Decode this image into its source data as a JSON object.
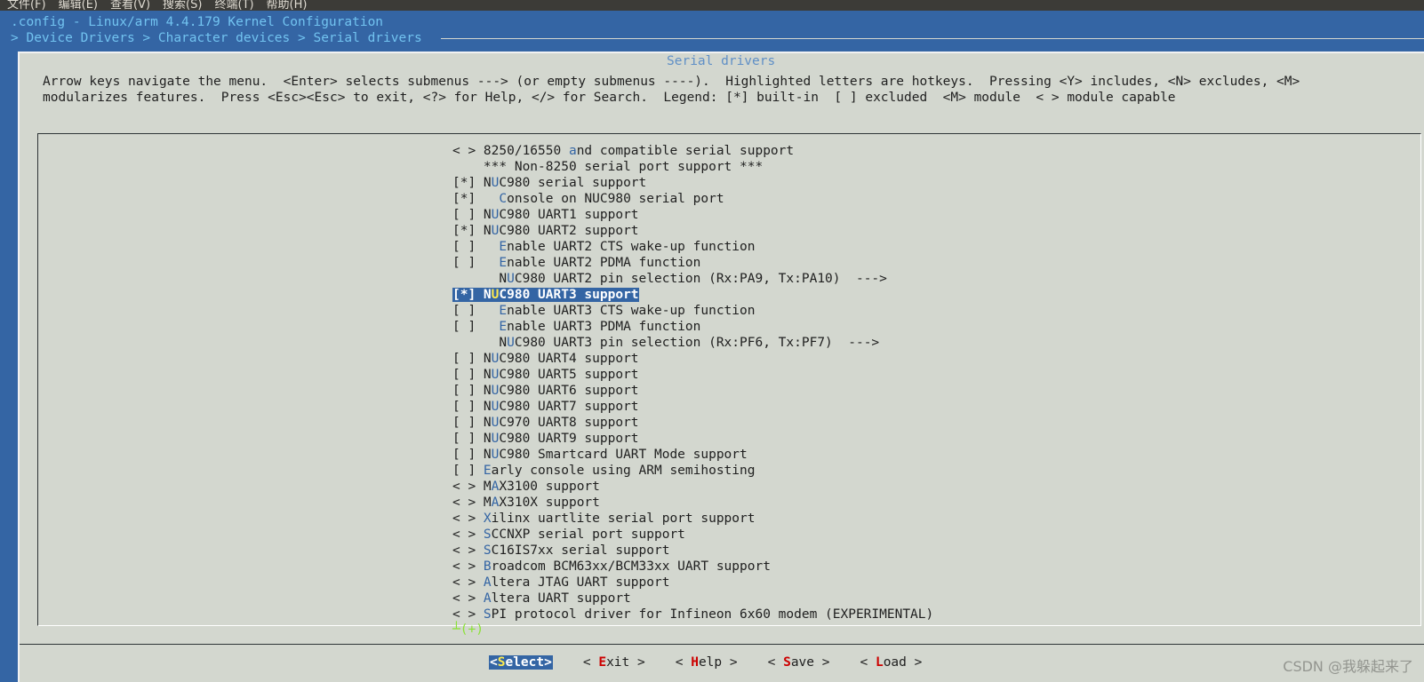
{
  "window_menu": [
    "文件(F)",
    "编辑(E)",
    "查看(V)",
    "搜索(S)",
    "终端(T)",
    "帮助(H)"
  ],
  "terminal": {
    "title": ".config - Linux/arm 4.4.179 Kernel Configuration",
    "breadcrumb": "> Device Drivers > Character devices > Serial drivers"
  },
  "dialog": {
    "title": "Serial drivers",
    "help_line1": "Arrow keys navigate the menu.  <Enter> selects submenus ---> (or empty submenus ----).  Highlighted letters are hotkeys.  Pressing <Y> includes, <N> excludes, <M>",
    "help_line2": "modularizes features.  Press <Esc><Esc> to exit, <?> for Help, </> for Search.  Legend: [*] built-in  [ ] excluded  <M> module  < > module capable"
  },
  "menu_items": [
    {
      "prefix": "< > ",
      "pre": "8250/16550 ",
      "hk": "a",
      "post": "nd compatible serial support"
    },
    {
      "prefix": "    ",
      "pre": "*** Non-8250 serial port support ***",
      "hk": "",
      "post": ""
    },
    {
      "prefix": "[*] ",
      "pre": "N",
      "hk": "U",
      "post": "C980 serial support"
    },
    {
      "prefix": "[*]   ",
      "pre": "",
      "hk": "C",
      "post": "onsole on NUC980 serial port"
    },
    {
      "prefix": "[ ] ",
      "pre": "N",
      "hk": "U",
      "post": "C980 UART1 support"
    },
    {
      "prefix": "[*] ",
      "pre": "N",
      "hk": "U",
      "post": "C980 UART2 support"
    },
    {
      "prefix": "[ ]   ",
      "pre": "",
      "hk": "E",
      "post": "nable UART2 CTS wake-up function"
    },
    {
      "prefix": "[ ]   ",
      "pre": "",
      "hk": "E",
      "post": "nable UART2 PDMA function"
    },
    {
      "prefix": "      ",
      "pre": "N",
      "hk": "U",
      "post": "C980 UART2 pin selection (Rx:PA9, Tx:PA10)  --->"
    },
    {
      "prefix": "[*] ",
      "pre": "N",
      "hk": "U",
      "post": "C980 UART3 support",
      "selected": true
    },
    {
      "prefix": "[ ]   ",
      "pre": "",
      "hk": "E",
      "post": "nable UART3 CTS wake-up function"
    },
    {
      "prefix": "[ ]   ",
      "pre": "",
      "hk": "E",
      "post": "nable UART3 PDMA function"
    },
    {
      "prefix": "      ",
      "pre": "N",
      "hk": "U",
      "post": "C980 UART3 pin selection (Rx:PF6, Tx:PF7)  --->"
    },
    {
      "prefix": "[ ] ",
      "pre": "N",
      "hk": "U",
      "post": "C980 UART4 support"
    },
    {
      "prefix": "[ ] ",
      "pre": "N",
      "hk": "U",
      "post": "C980 UART5 support"
    },
    {
      "prefix": "[ ] ",
      "pre": "N",
      "hk": "U",
      "post": "C980 UART6 support"
    },
    {
      "prefix": "[ ] ",
      "pre": "N",
      "hk": "U",
      "post": "C980 UART7 support"
    },
    {
      "prefix": "[ ] ",
      "pre": "N",
      "hk": "U",
      "post": "C970 UART8 support"
    },
    {
      "prefix": "[ ] ",
      "pre": "N",
      "hk": "U",
      "post": "C980 UART9 support"
    },
    {
      "prefix": "[ ] ",
      "pre": "N",
      "hk": "U",
      "post": "C980 Smartcard UART Mode support"
    },
    {
      "prefix": "[ ] ",
      "pre": "",
      "hk": "E",
      "post": "arly console using ARM semihosting"
    },
    {
      "prefix": "< > ",
      "pre": "M",
      "hk": "A",
      "post": "X3100 support"
    },
    {
      "prefix": "< > ",
      "pre": "M",
      "hk": "A",
      "post": "X310X support"
    },
    {
      "prefix": "< > ",
      "pre": "",
      "hk": "X",
      "post": "ilinx uartlite serial port support"
    },
    {
      "prefix": "< > ",
      "pre": "",
      "hk": "S",
      "post": "CCNXP serial port support"
    },
    {
      "prefix": "< > ",
      "pre": "",
      "hk": "S",
      "post": "C16IS7xx serial support"
    },
    {
      "prefix": "< > ",
      "pre": "",
      "hk": "B",
      "post": "roadcom BCM63xx/BCM33xx UART support"
    },
    {
      "prefix": "< > ",
      "pre": "",
      "hk": "A",
      "post": "ltera JTAG UART support"
    },
    {
      "prefix": "< > ",
      "pre": "",
      "hk": "A",
      "post": "ltera UART support"
    },
    {
      "prefix": "< > ",
      "pre": "",
      "hk": "S",
      "post": "PI protocol driver for Infineon 6x60 modem (EXPERIMENTAL)"
    }
  ],
  "more_indicator": "┴(+)",
  "buttons": [
    {
      "open": "<",
      "hk": "S",
      "rest": "elect",
      "close": ">",
      "active": true
    },
    {
      "open": "< ",
      "hk": "E",
      "rest": "xit",
      "close": " >"
    },
    {
      "open": "< ",
      "hk": "H",
      "rest": "elp",
      "close": " >"
    },
    {
      "open": "< ",
      "hk": "S",
      "rest": "ave",
      "close": " >"
    },
    {
      "open": "< ",
      "hk": "L",
      "rest": "oad",
      "close": " >"
    }
  ],
  "watermark": "CSDN @我躲起来了"
}
